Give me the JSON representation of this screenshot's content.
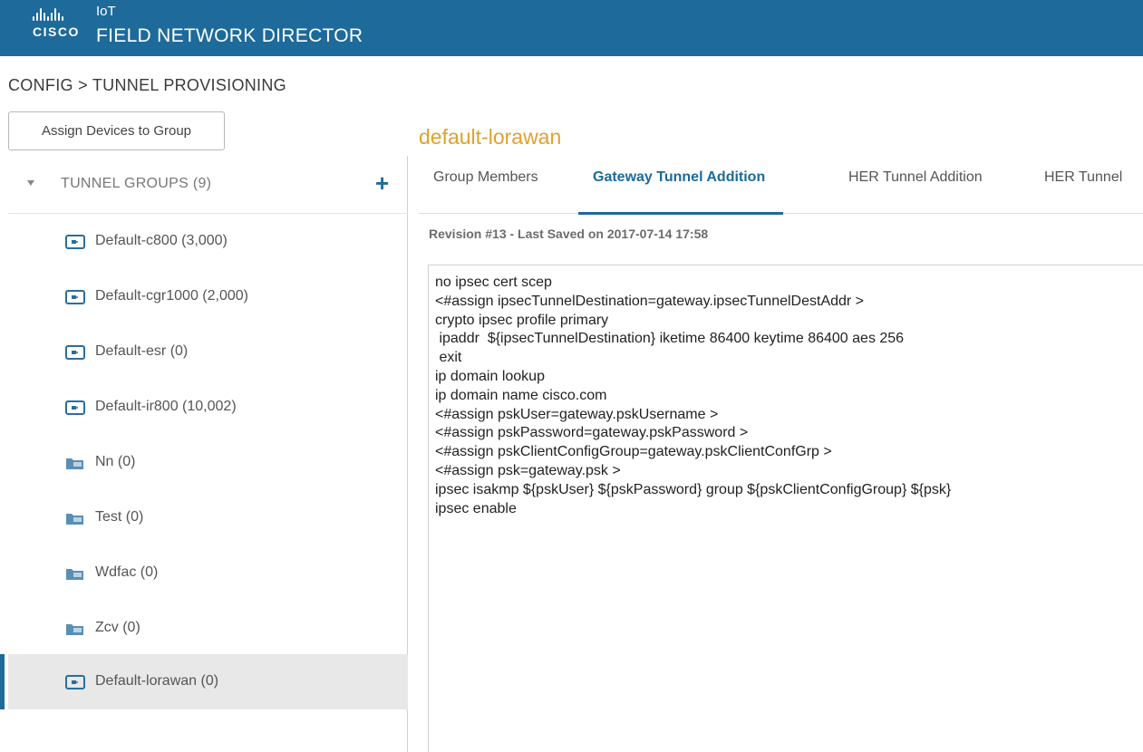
{
  "header": {
    "brand": "CISCO",
    "product_line": "IoT",
    "app_name": "FIELD NETWORK DIRECTOR",
    "accent_color": "#1d6a9b"
  },
  "breadcrumb": "CONFIG > TUNNEL PROVISIONING",
  "assign_button_label": "Assign Devices to Group",
  "sidebar": {
    "group_title": "TUNNEL GROUPS (9)",
    "items": [
      {
        "label": "Default-c800 (3,000)",
        "icon": "router-group-icon"
      },
      {
        "label": "Default-cgr1000 (2,000)",
        "icon": "router-group-icon"
      },
      {
        "label": "Default-esr (0)",
        "icon": "router-group-icon"
      },
      {
        "label": "Default-ir800 (10,002)",
        "icon": "router-group-icon"
      },
      {
        "label": "Nn (0)",
        "icon": "folder-icon"
      },
      {
        "label": "Test (0)",
        "icon": "folder-icon"
      },
      {
        "label": "Wdfac (0)",
        "icon": "folder-icon"
      },
      {
        "label": "Zcv (0)",
        "icon": "folder-icon"
      },
      {
        "label": "Default-lorawan (0)",
        "icon": "router-group-icon",
        "selected": true
      }
    ]
  },
  "main": {
    "title": "default-lorawan",
    "title_color": "#e2a02c",
    "tabs": [
      {
        "label": "Group Members",
        "active": false
      },
      {
        "label": "Gateway Tunnel Addition",
        "active": true
      },
      {
        "label": "HER Tunnel Addition",
        "active": false
      },
      {
        "label": "HER Tunnel",
        "active": false
      }
    ],
    "revision": "Revision #13 - Last Saved on 2017-07-14 17:58",
    "code_lines": [
      "no ipsec cert scep",
      "<#assign ipsecTunnelDestination=gateway.ipsecTunnelDestAddr >",
      "crypto ipsec profile primary",
      " ipaddr  ${ipsecTunnelDestination} iketime 86400 keytime 86400 aes 256",
      " exit",
      "ip domain lookup",
      "ip domain name cisco.com",
      "<#assign pskUser=gateway.pskUsername >",
      "<#assign pskPassword=gateway.pskPassword >",
      "<#assign pskClientConfigGroup=gateway.pskClientConfGrp >",
      "<#assign psk=gateway.psk >",
      "ipsec isakmp ${pskUser} ${pskPassword} group ${pskClientConfigGroup} ${psk}",
      "ipsec enable"
    ]
  }
}
